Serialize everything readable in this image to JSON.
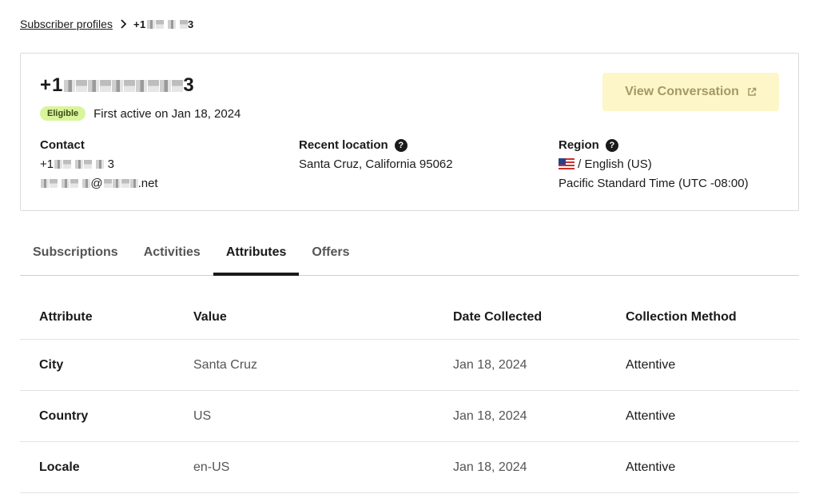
{
  "breadcrumb": {
    "parent_label": "Subscriber profiles",
    "current_prefix": "+1",
    "current_suffix": "3"
  },
  "profile": {
    "phone_prefix": "+1",
    "phone_suffix": "3",
    "badge": "Eligible",
    "first_active": "First active on Jan 18, 2024",
    "view_button_label": "View Conversation",
    "contact": {
      "label": "Contact",
      "phone_prefix": "+1",
      "phone_suffix": "3",
      "email_at": "@",
      "email_suffix": ".net"
    },
    "location": {
      "label": "Recent location",
      "value": "Santa Cruz, California 95062"
    },
    "region": {
      "label": "Region",
      "language": "/ English (US)",
      "timezone": "Pacific Standard Time (UTC -08:00)"
    }
  },
  "tabs": [
    {
      "label": "Subscriptions",
      "active": false
    },
    {
      "label": "Activities",
      "active": false
    },
    {
      "label": "Attributes",
      "active": true
    },
    {
      "label": "Offers",
      "active": false
    }
  ],
  "table": {
    "headers": [
      "Attribute",
      "Value",
      "Date Collected",
      "Collection Method"
    ],
    "rows": [
      {
        "attribute": "City",
        "value": "Santa Cruz",
        "date": "Jan 18, 2024",
        "method": "Attentive"
      },
      {
        "attribute": "Country",
        "value": "US",
        "date": "Jan 18, 2024",
        "method": "Attentive"
      },
      {
        "attribute": "Locale",
        "value": "en-US",
        "date": "Jan 18, 2024",
        "method": "Attentive"
      }
    ]
  },
  "colors": {
    "badge_bg": "#d9f59c",
    "button_bg": "#fdf6c8",
    "button_text": "#a39a66"
  },
  "icons": {
    "breadcrumb_separator": "chevron-right-icon",
    "external_link": "external-link-icon",
    "help": "question-circle-icon",
    "flag": "us-flag-icon"
  }
}
